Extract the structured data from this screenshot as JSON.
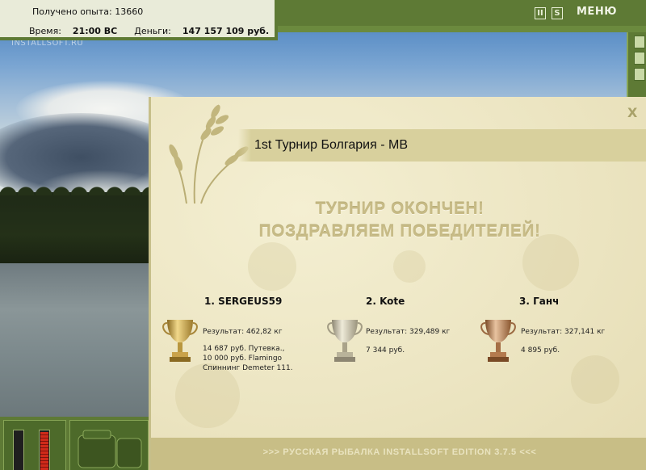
{
  "hud": {
    "experience_label": "Получено опыта:",
    "experience_value": "13660",
    "time_label": "Время:",
    "time_value": "21:00 ВС",
    "money_label": "Деньги:",
    "money_value": "147 157 109 руб."
  },
  "watermark": "INSTALLSOFT.RU",
  "topbar": {
    "pause_glyph": "II",
    "save_glyph": "S",
    "menu_label": "МЕНЮ"
  },
  "dialog": {
    "close_glyph": "X",
    "title": "1st Турнир Болгария - МВ",
    "headline_line1": "ТУРНИР ОКОНЧЕН!",
    "headline_line2": "ПОЗДРАВЛЯЕМ ПОБЕДИТЕЛЕЙ!",
    "winners": [
      {
        "place_name": "1. SERGEUS59",
        "result": "Результат: 462,82 кг",
        "prize_lines": [
          "14 687 руб. Путевка.,",
          "10 000 руб. Flamingo",
          "Спиннинг Demeter 111."
        ],
        "trophy": "gold-trophy"
      },
      {
        "place_name": "2. Kote",
        "result": "Результат: 329,489 кг",
        "prize_lines": [
          "7 344 руб."
        ],
        "trophy": "silver-trophy"
      },
      {
        "place_name": "3. Ганч",
        "result": "Результат: 327,141 кг",
        "prize_lines": [
          "4 895 руб."
        ],
        "trophy": "bronze-trophy"
      }
    ],
    "footer": ">>> РУССКАЯ РЫБАЛКА INSTALLSOFT EDITION 3.7.5 <<<"
  },
  "colors": {
    "frame_green": "#5e7a35",
    "parchment": "#efe9c7",
    "headline": "#c7bb86",
    "gold": "#c9a24a",
    "silver": "#b9b39a",
    "bronze": "#b47a4e"
  }
}
